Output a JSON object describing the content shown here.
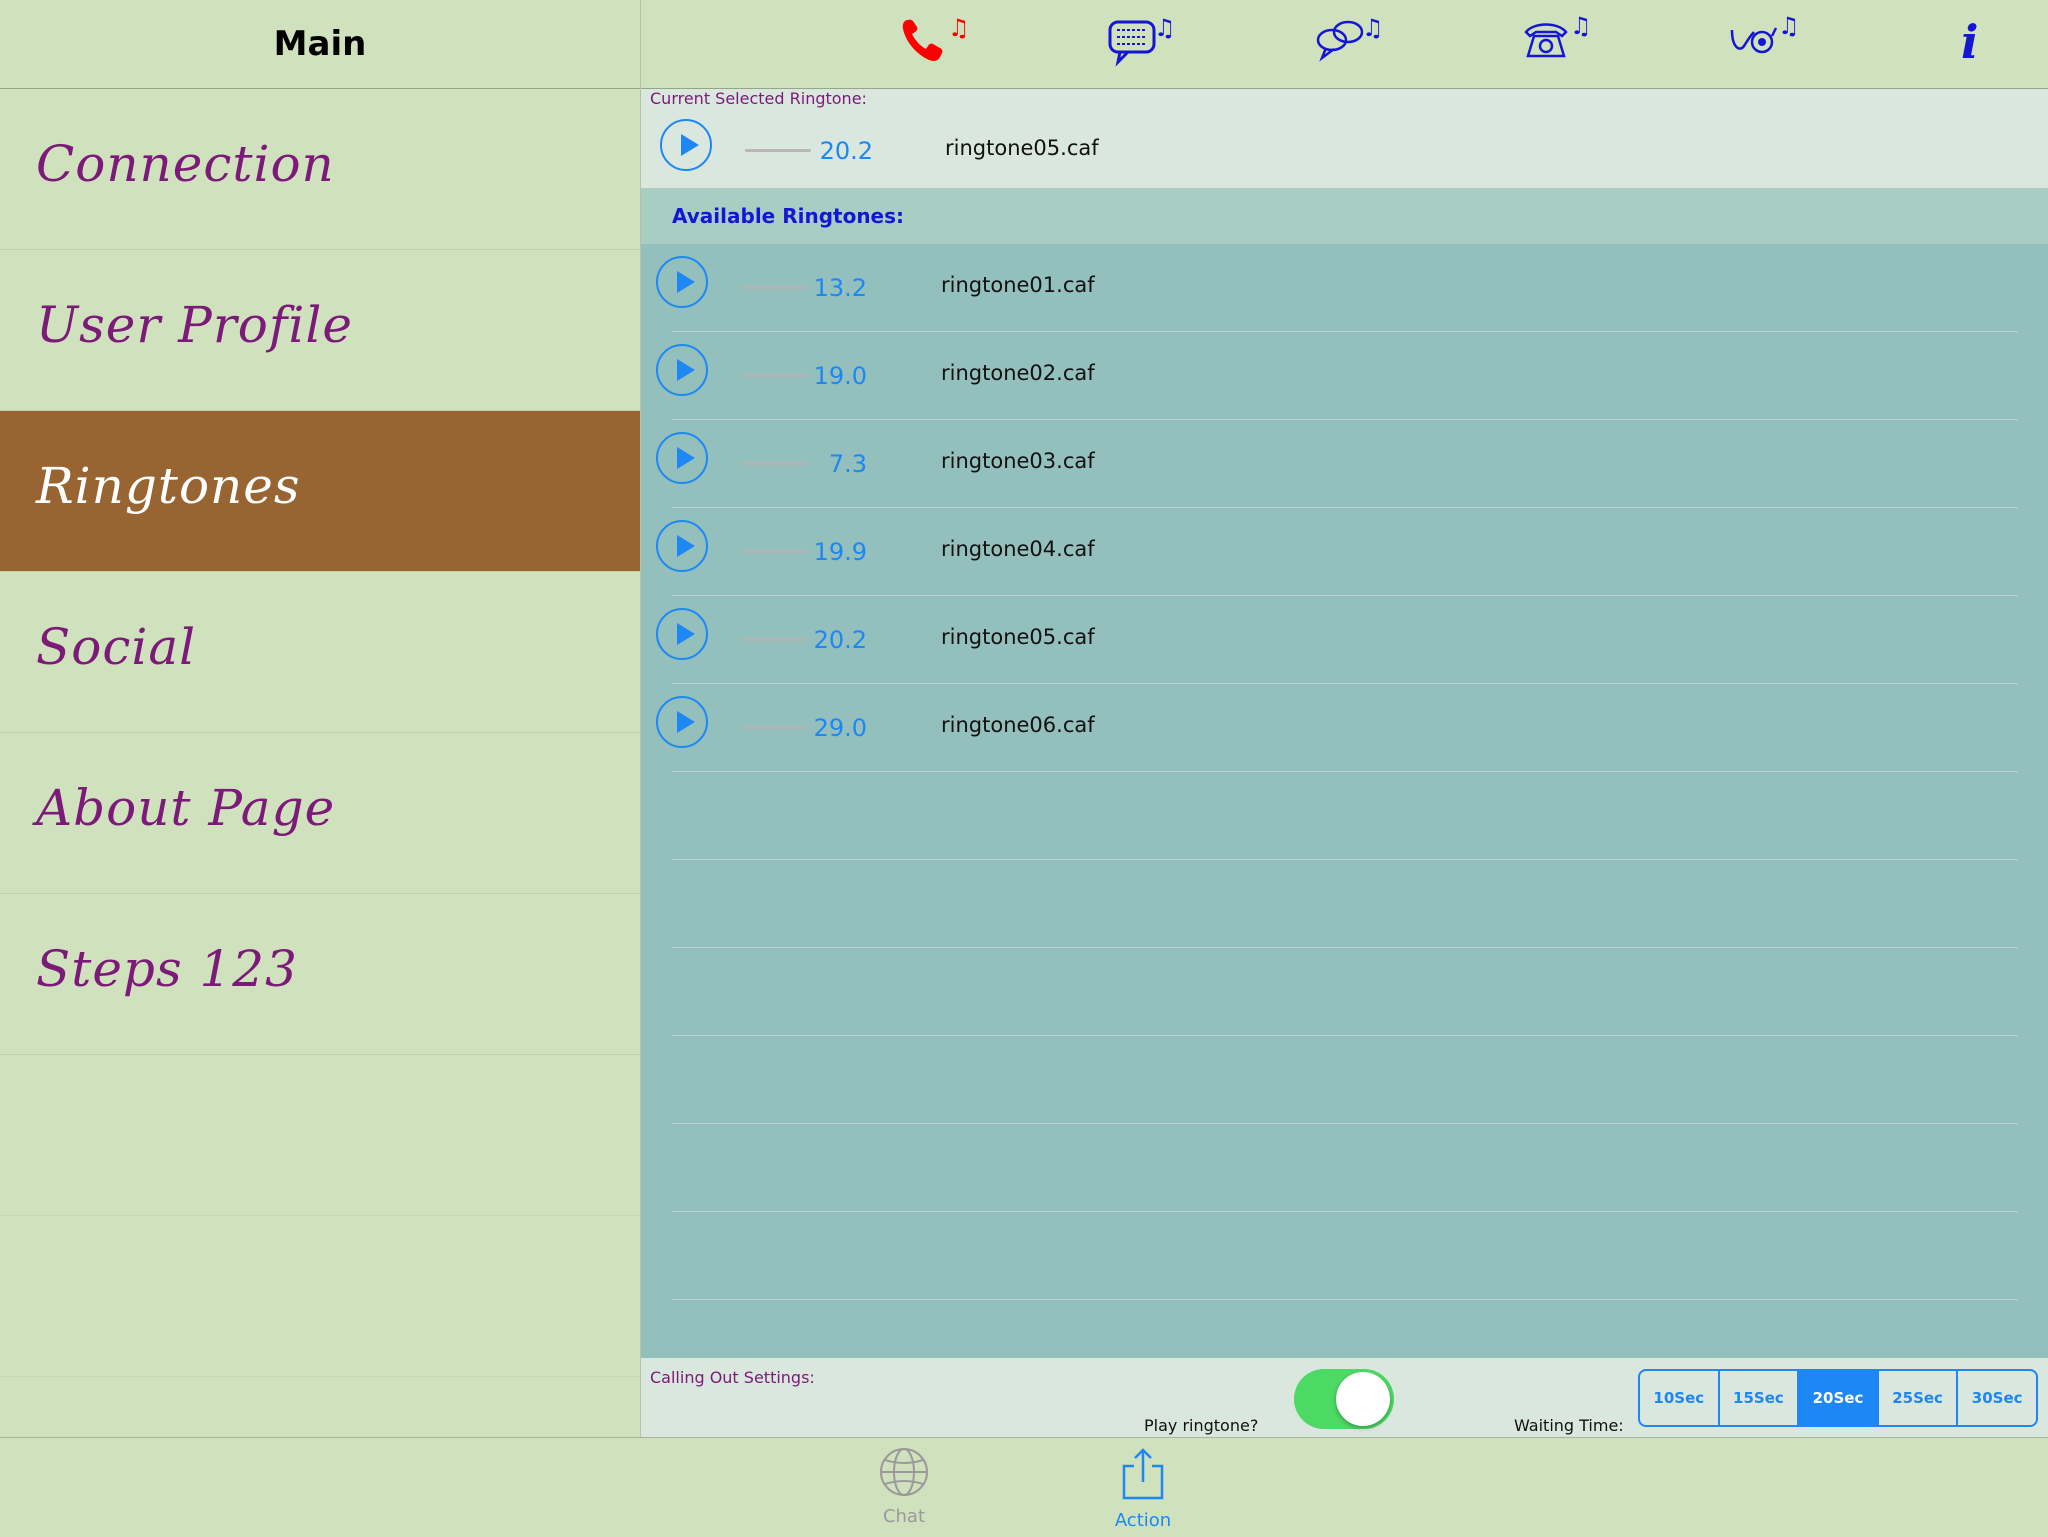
{
  "sidebar": {
    "title": "Main",
    "items": [
      {
        "label": "Connection",
        "selected": false
      },
      {
        "label": "User Profile",
        "selected": false
      },
      {
        "label": "Ringtones",
        "selected": true
      },
      {
        "label": "Social",
        "selected": false
      },
      {
        "label": "About Page",
        "selected": false
      },
      {
        "label": "Steps 123",
        "selected": false
      }
    ]
  },
  "toolbar": {
    "icons": [
      "phone-ringtone-icon",
      "message-ringtone-icon",
      "chat-ringtone-icon",
      "telephone-ringtone-icon",
      "voicemail-ringtone-icon",
      "info-icon"
    ],
    "active_color": "#ff0000",
    "icon_color": "#1515d6"
  },
  "current": {
    "label": "Current Selected Ringtone:",
    "duration": "20.2",
    "filename": "ringtone05.caf"
  },
  "available": {
    "title": "Available Ringtones:",
    "ringtones": [
      {
        "duration": "13.2",
        "filename": "ringtone01.caf"
      },
      {
        "duration": "19.0",
        "filename": "ringtone02.caf"
      },
      {
        "duration": "7.3",
        "filename": "ringtone03.caf"
      },
      {
        "duration": "19.9",
        "filename": "ringtone04.caf"
      },
      {
        "duration": "20.2",
        "filename": "ringtone05.caf"
      },
      {
        "duration": "29.0",
        "filename": "ringtone06.caf"
      }
    ]
  },
  "settings": {
    "label": "Calling Out Settings:",
    "play_label": "Play ringtone?",
    "play_on": true,
    "wait_label": "Waiting Time:",
    "wait_options": [
      "10Sec",
      "15Sec",
      "20Sec",
      "25Sec",
      "30Sec"
    ],
    "wait_selected": "20Sec"
  },
  "tabbar": {
    "tabs": [
      {
        "label": "Chat",
        "active": false
      },
      {
        "label": "Action",
        "active": true
      }
    ]
  },
  "colors": {
    "accent": "#1c87f5",
    "sidebar_text": "#7b1a78",
    "selected_bg": "#986432",
    "list_bg": "#93bfbd"
  }
}
